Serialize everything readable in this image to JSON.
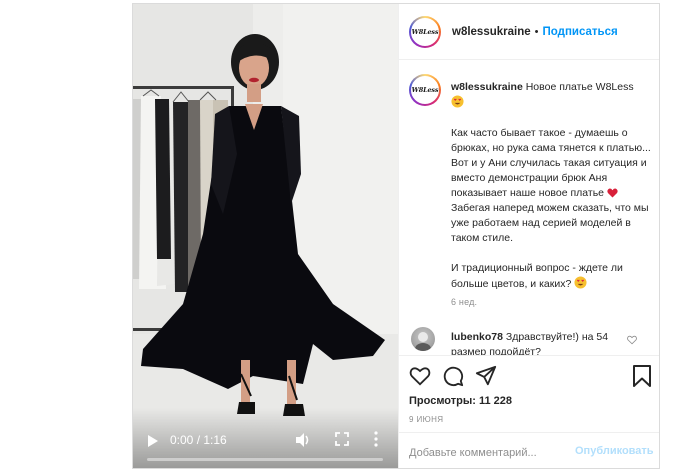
{
  "post": {
    "username": "w8lessukraine",
    "follow_label": "Подписаться",
    "header_dot": "•",
    "avatar_text": "W8Less",
    "caption_intro": "Новое платье W8Less",
    "caption_p1_a": "Как часто бывает такое - думаешь о брюках, но рука сама тянется к платью... Вот и у Ани случилась такая ситуация и вместо демонстрации брюк Аня показывает наше новое платье",
    "caption_p1_b": "Забегая наперед можем сказать, что мы уже работаем над серией моделей в таком стиле.",
    "caption_p2": "И традиционный вопрос - ждете ли больше цветов, и каких?",
    "caption_time": "6 нед.",
    "comment": {
      "username": "lubenko78",
      "text": "Здравствуйте!) на 54 размер подойдёт?"
    },
    "views_label": "Просмотры: 11 228",
    "date": "9 ИЮНЯ",
    "comment_placeholder": "Добавьте комментарий...",
    "publish_label": "Опубликовать"
  },
  "video": {
    "time": "0:00 / 1:16",
    "progress": 0.0
  },
  "icons": {
    "play": "play-icon",
    "mute": "volume-icon",
    "fullscreen": "fullscreen-icon",
    "more": "more-vertical-icon",
    "like": "heart-icon",
    "comment": "comment-icon",
    "share": "share-icon",
    "save": "bookmark-icon",
    "emoji_heart_eyes": "heart-eyes-emoji",
    "emoji_heart": "red-heart-emoji"
  },
  "colors": {
    "link": "#0095f6",
    "publish_disabled": "#b2dffc",
    "secondary_text": "#8e8e8e"
  }
}
